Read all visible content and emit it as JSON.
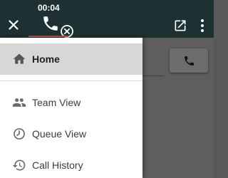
{
  "topbar": {
    "call_timer": "00:04"
  },
  "nav": {
    "items": [
      {
        "label": "Home",
        "icon": "home-icon",
        "active": true
      },
      {
        "label": "Team View",
        "icon": "people-icon",
        "active": false
      },
      {
        "label": "Queue View",
        "icon": "timer-icon",
        "active": false
      },
      {
        "label": "Call History",
        "icon": "history-icon",
        "active": false
      }
    ]
  },
  "colors": {
    "topbar": "#1d3132",
    "call_underline": "#d04a4a",
    "active_item": "#d7d7d7",
    "overlay": "#595959"
  }
}
